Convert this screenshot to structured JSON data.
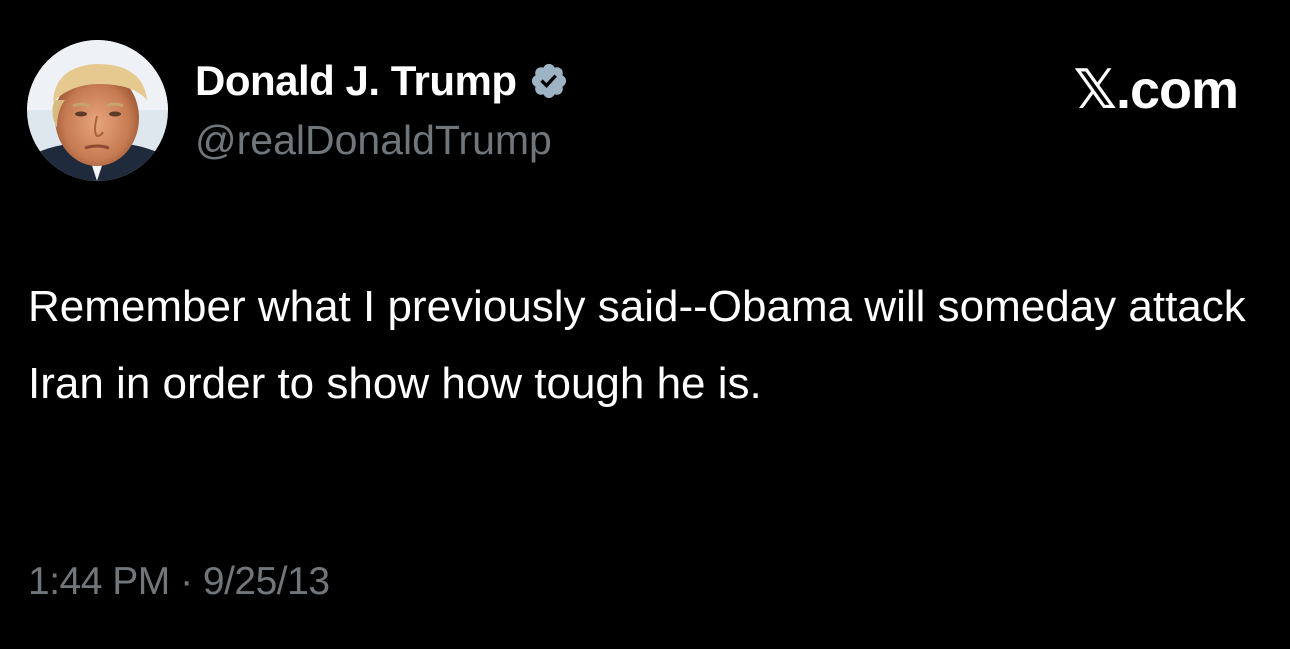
{
  "author": {
    "display_name": "Donald J. Trump",
    "handle": "@realDonaldTrump",
    "verified": true,
    "verified_badge_color": "#9eb4c5",
    "avatar_icon": "profile-photo"
  },
  "brand": {
    "label": "𝕏.com"
  },
  "tweet": {
    "text": "Remember what I previously said--Obama will someday attack Iran in order to show how tough he is.",
    "timestamp": "1:44 PM · 9/25/13"
  },
  "colors": {
    "background": "#000000",
    "text_primary": "#ffffff",
    "text_secondary": "#71767b"
  }
}
